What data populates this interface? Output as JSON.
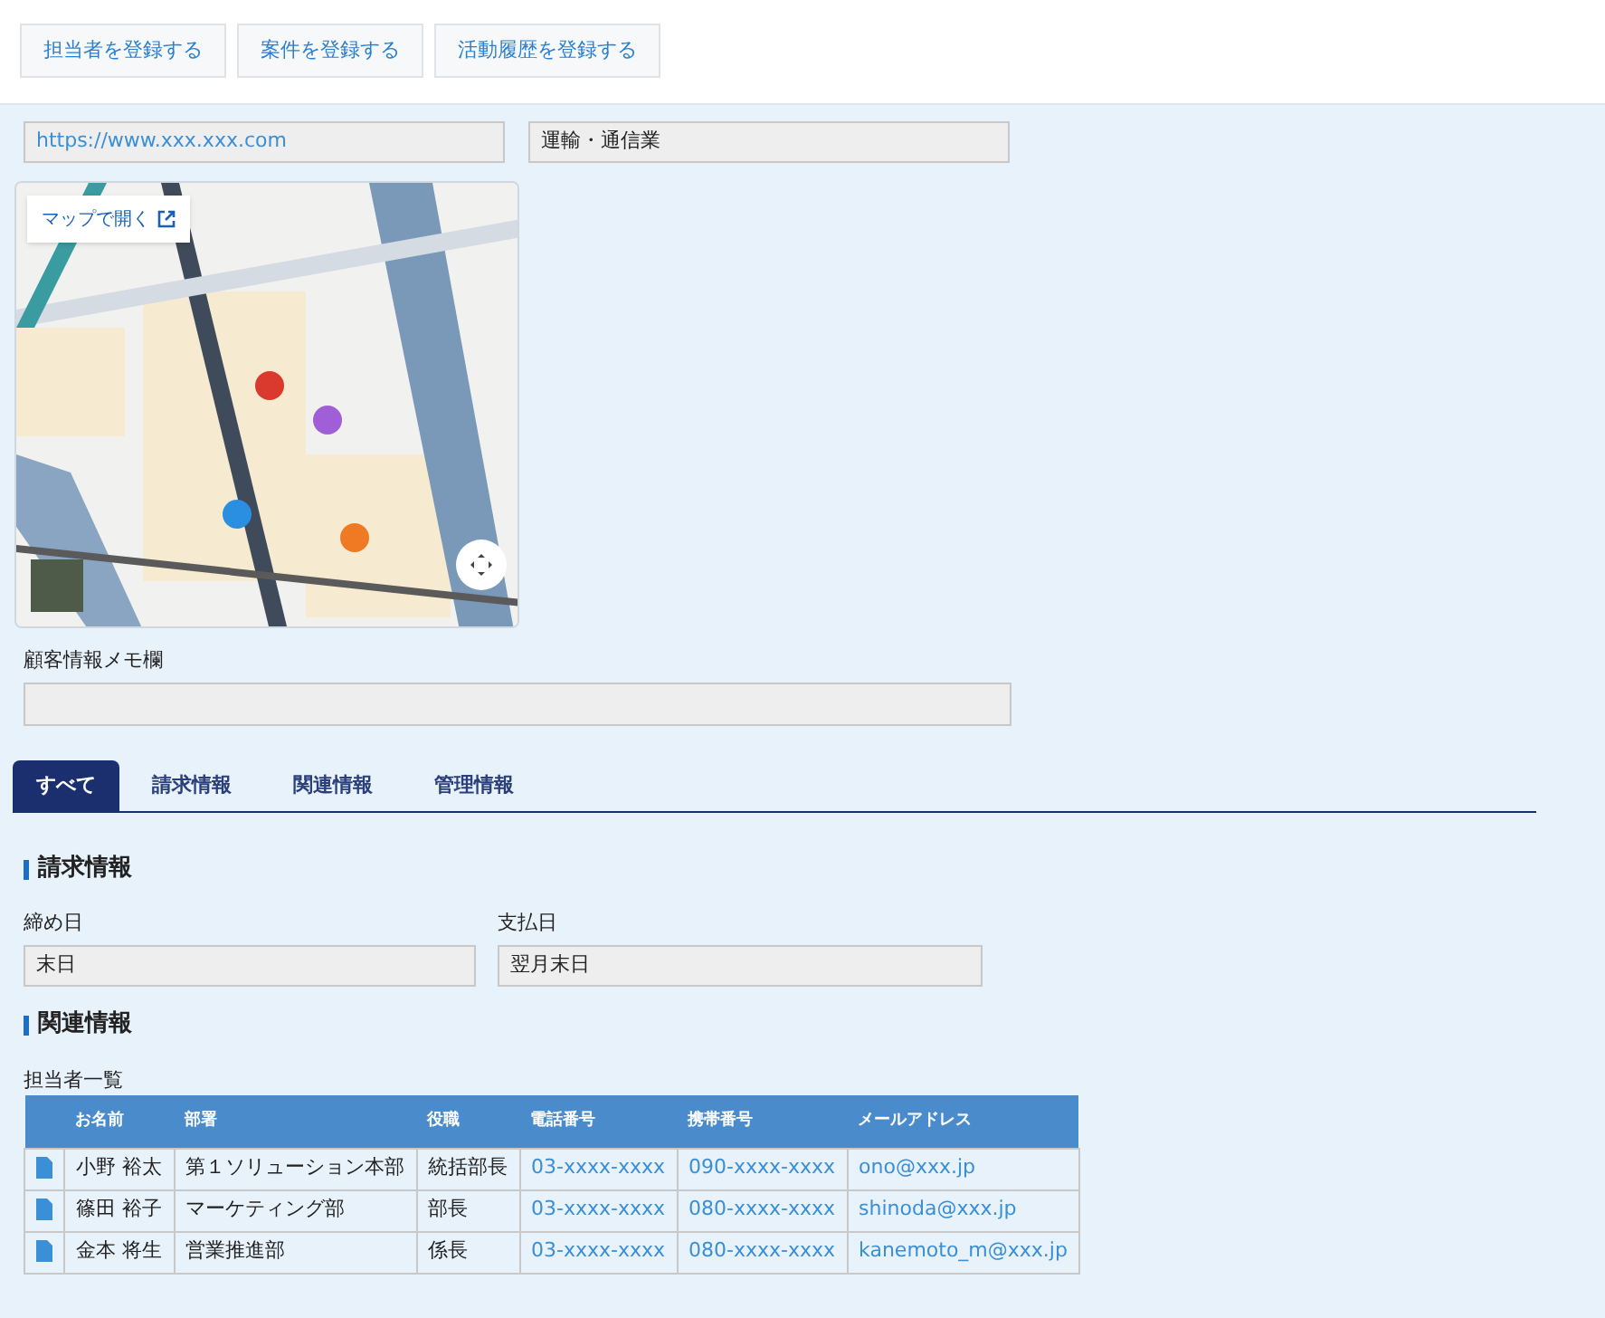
{
  "actions": [
    "担当者を登録する",
    "案件を登録する",
    "活動履歴を登録する"
  ],
  "website": {
    "value": "https://www.xxx.xxx.com"
  },
  "industry": {
    "value": "運輸・通信業"
  },
  "map": {
    "open_link": "マップで開く"
  },
  "memo": {
    "label": "顧客情報メモ欄"
  },
  "tabs": [
    {
      "label": "すべて",
      "selected": true
    },
    {
      "label": "請求情報",
      "selected": false
    },
    {
      "label": "関連情報",
      "selected": false
    },
    {
      "label": "管理情報",
      "selected": false
    }
  ],
  "billing": {
    "heading": "請求情報",
    "fields": [
      {
        "label": "締め日",
        "value": "末日"
      },
      {
        "label": "支払日",
        "value": "翌月末日"
      }
    ]
  },
  "related": {
    "heading": "関連情報",
    "table_title": "担当者一覧",
    "columns": [
      "お名前",
      "部署",
      "役職",
      "電話番号",
      "携帯番号",
      "メールアドレス"
    ],
    "rows": [
      {
        "name": "小野 裕太",
        "department": "第１ソリューション本部",
        "title": "統括部長",
        "phone": "03-xxxx-xxxx",
        "mobile": "090-xxxx-xxxx",
        "email": "ono@xxx.jp"
      },
      {
        "name": "篠田 裕子",
        "department": "マーケティング部",
        "title": "部長",
        "phone": "03-xxxx-xxxx",
        "mobile": "080-xxxx-xxxx",
        "email": "shinoda@xxx.jp"
      },
      {
        "name": "金本 将生",
        "department": "営業推進部",
        "title": "係長",
        "phone": "03-xxxx-xxxx",
        "mobile": "080-xxxx-xxxx",
        "email": "kanemoto_m@xxx.jp"
      }
    ]
  }
}
